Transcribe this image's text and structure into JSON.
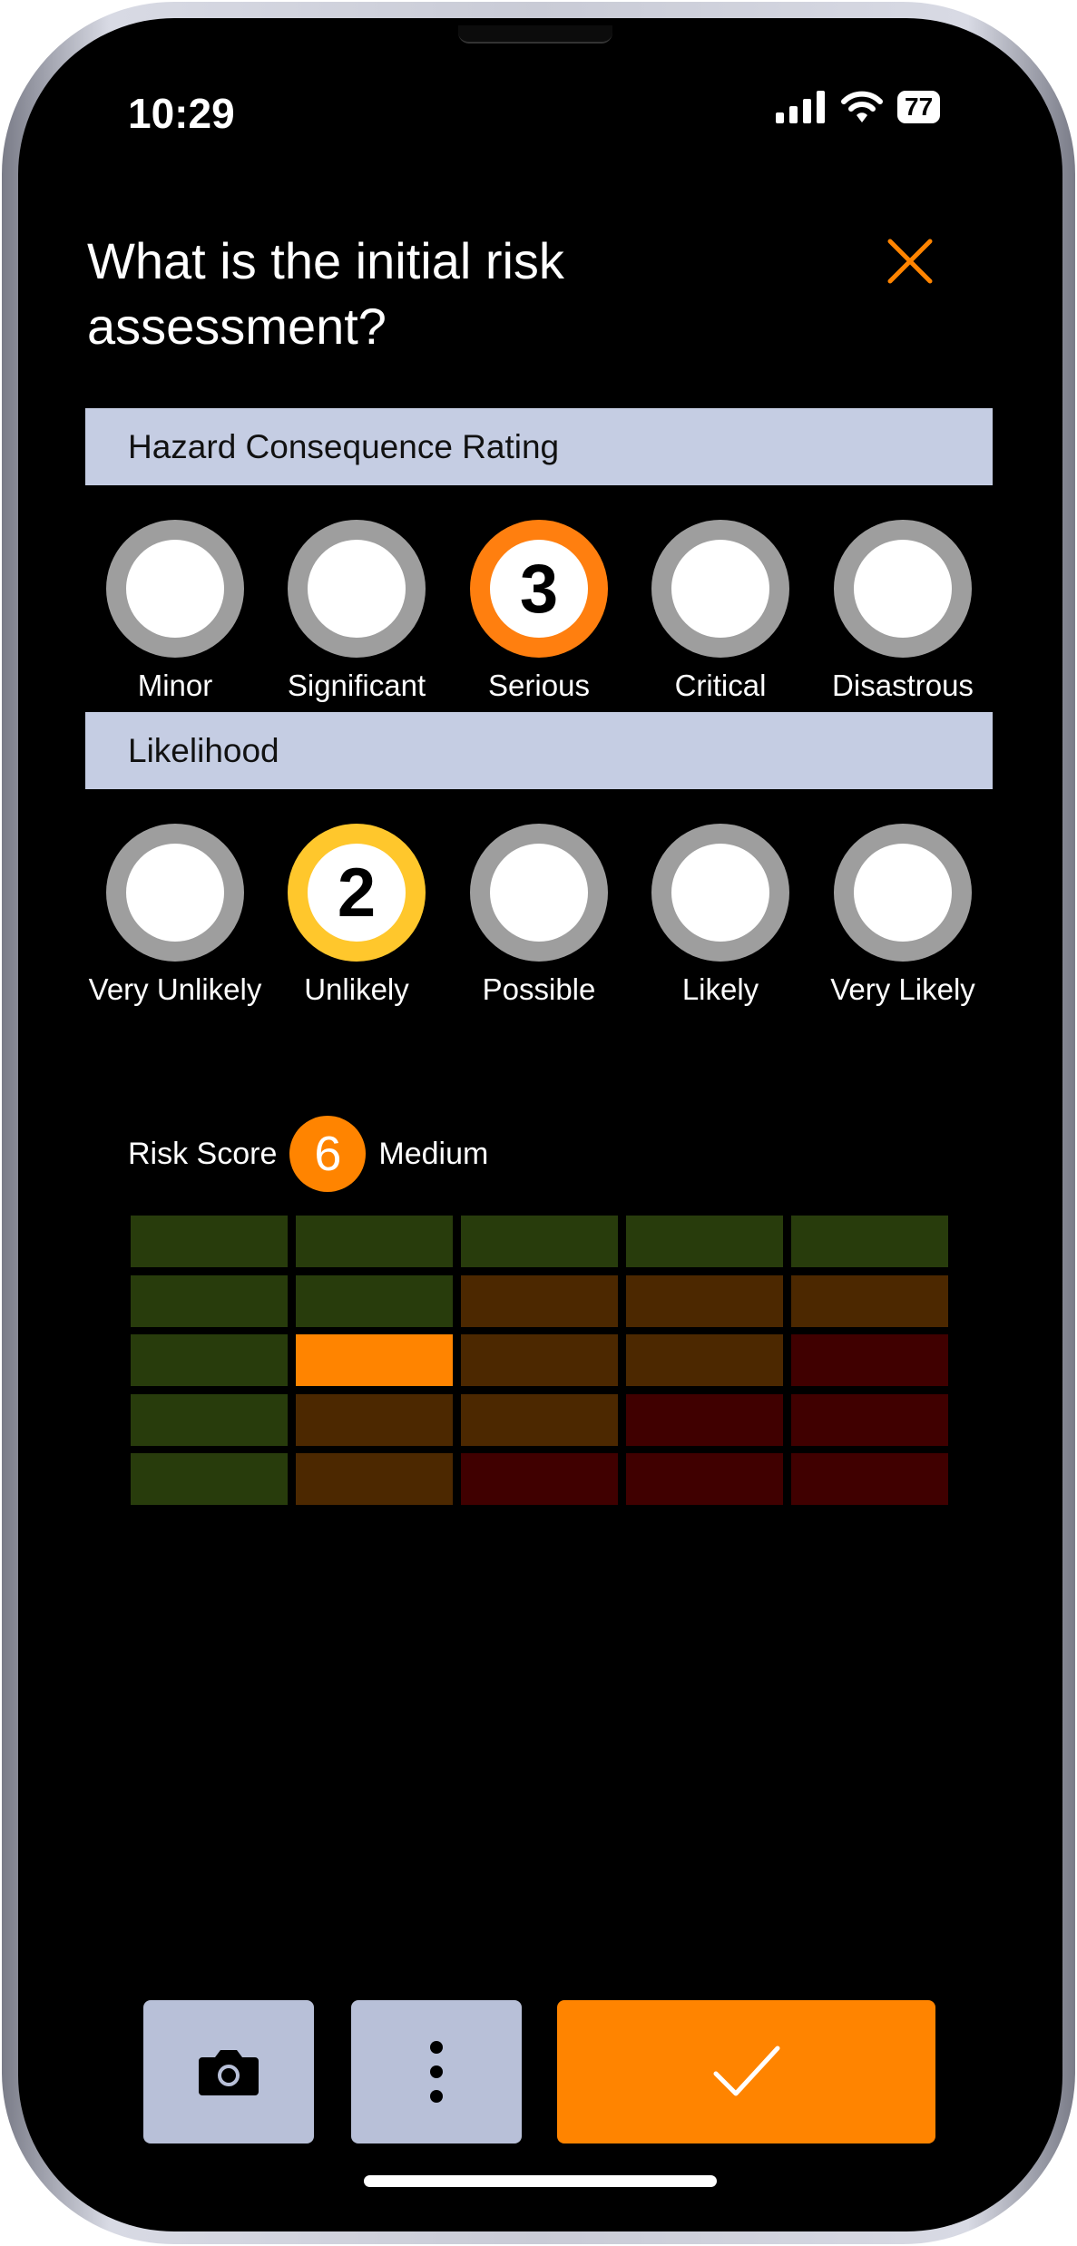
{
  "status_bar": {
    "time": "10:29",
    "battery": "77"
  },
  "title": "What is the initial risk assessment?",
  "consequence": {
    "heading": "Hazard Consequence Rating",
    "selected": 3,
    "selected_color": "#ff7f0f",
    "options": [
      {
        "label": "Minor",
        "value": ""
      },
      {
        "label": "Significant",
        "value": ""
      },
      {
        "label": "Serious",
        "value": "3"
      },
      {
        "label": "Critical",
        "value": ""
      },
      {
        "label": "Disastrous",
        "value": ""
      }
    ]
  },
  "likelihood": {
    "heading": "Likelihood",
    "selected": 2,
    "selected_color": "#ffc72c",
    "options": [
      {
        "label": "Very Unlikely",
        "value": ""
      },
      {
        "label": "Unlikely",
        "value": "2"
      },
      {
        "label": "Possible",
        "value": ""
      },
      {
        "label": "Likely",
        "value": ""
      },
      {
        "label": "Very Likely",
        "value": ""
      }
    ]
  },
  "risk": {
    "label": "Risk Score",
    "score": "6",
    "level": "Medium",
    "color": "#ff8400"
  },
  "matrix": {
    "colors": {
      "low": "#283c0c",
      "medium": "#4c2800",
      "high": "#400000",
      "selected": "#ff8400"
    },
    "rows": [
      [
        "low",
        "low",
        "low",
        "low",
        "low"
      ],
      [
        "low",
        "low",
        "medium",
        "medium",
        "medium"
      ],
      [
        "low",
        "selected",
        "medium",
        "medium",
        "high"
      ],
      [
        "low",
        "medium",
        "medium",
        "high",
        "high"
      ],
      [
        "low",
        "medium",
        "high",
        "high",
        "high"
      ]
    ]
  },
  "actions": {
    "camera_icon": "camera-icon",
    "more_icon": "more-vertical-icon",
    "confirm_icon": "check-icon",
    "accent": "#ff8400",
    "button_bg": "#b8c0d8"
  }
}
